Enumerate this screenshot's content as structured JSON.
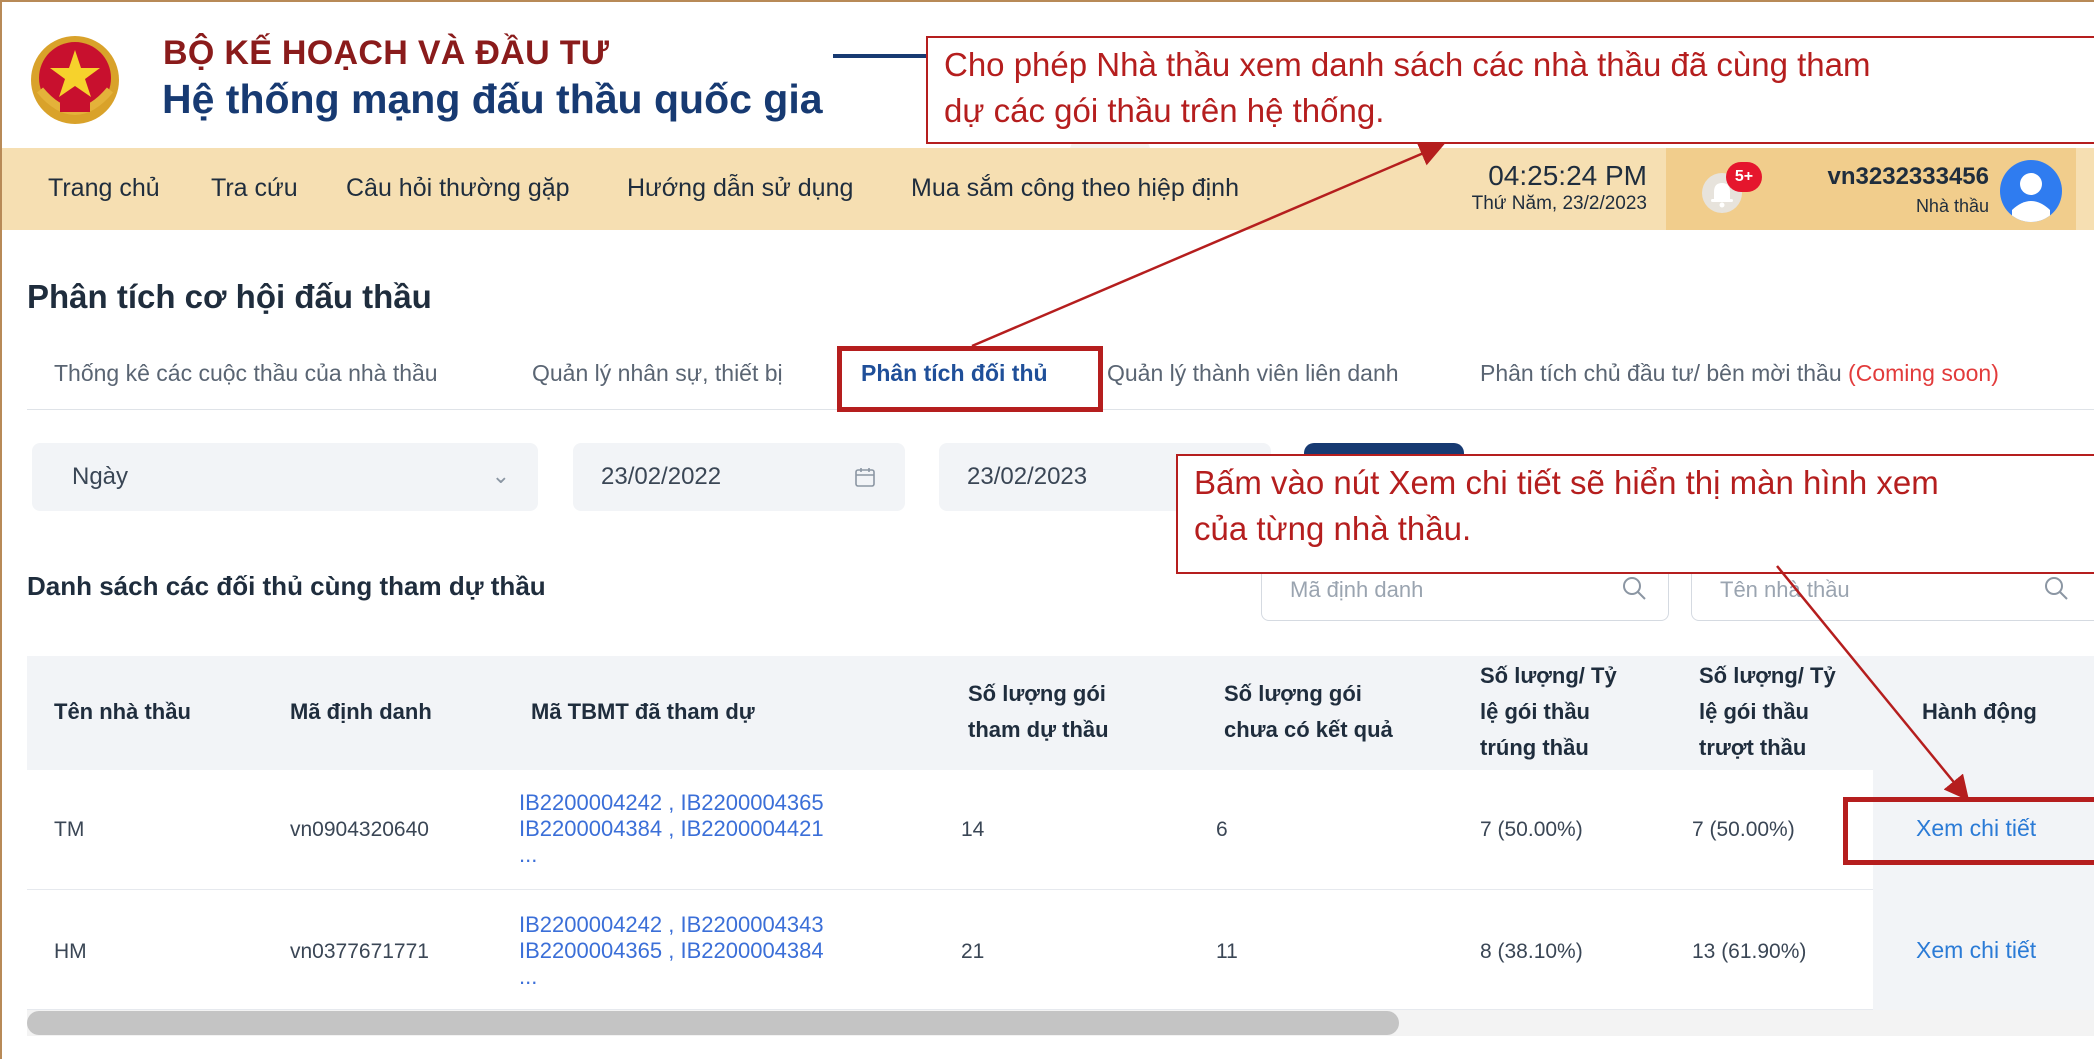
{
  "header": {
    "ministry": "BỘ KẾ HOẠCH VÀ ĐẦU TƯ",
    "system_name": "Hệ thống mạng đấu thầu quốc gia"
  },
  "nav": {
    "items": [
      {
        "label": "Trang chủ"
      },
      {
        "label": "Tra cứu"
      },
      {
        "label": "Câu hỏi thường gặp"
      },
      {
        "label": "Hướng dẫn sử dụng"
      },
      {
        "label": "Mua sắm công theo hiệp định"
      }
    ],
    "time": "04:25:24 PM",
    "date": "Thứ Năm, 23/2/2023",
    "notification_badge": "5+",
    "user_id": "vn3232333456",
    "user_role": "Nhà thầu"
  },
  "page": {
    "title": "Phân tích cơ hội đấu thầu",
    "tabs": [
      {
        "label": "Thống kê các cuộc thầu của nhà thầu"
      },
      {
        "label": "Quản lý nhân sự, thiết bị"
      },
      {
        "label": "Phân tích đối thủ"
      },
      {
        "label": "Quản lý thành viên liên danh"
      },
      {
        "label": "Phân tích chủ đầu tư/ bên mời thầu "
      }
    ],
    "coming_soon": "(Coming soon)"
  },
  "filters": {
    "period": "Ngày",
    "date_from": "23/02/2022",
    "date_to": "23/02/2023"
  },
  "list": {
    "title": "Danh sách các đối thủ cùng tham dự thầu",
    "search_code_placeholder": "Mã định danh",
    "search_name_placeholder": "Tên nhà thầu"
  },
  "table": {
    "headers": {
      "name": "Tên nhà thầu",
      "code": "Mã định danh",
      "tbmt": "Mã TBMT đã tham dự",
      "count_l1": "Số lượng gói",
      "count_l2": "tham dự thầu",
      "pending_l1": "Số lượng gói",
      "pending_l2": "chưa có kết quả",
      "won_l1": "Số lượng/ Tỷ",
      "won_l2": "lệ gói thầu",
      "won_l3": "trúng thầu",
      "lost_l1": "Số lượng/ Tỷ",
      "lost_l2": "lệ gói thầu",
      "lost_l3": "trượt thầu",
      "action": "Hành động"
    },
    "rows": [
      {
        "name": "TM",
        "code": "vn0904320640",
        "codes_l1": "IB2200004242 , IB2200004365",
        "codes_l2": "IB2200004384 , IB2200004421",
        "codes_more": "...",
        "participated": "14",
        "pending": "6",
        "won": "7 (50.00%)",
        "lost": "7 (50.00%)",
        "action": "Xem chi tiết"
      },
      {
        "name": "HM",
        "code": "vn0377671771",
        "codes_l1": "IB2200004242 , IB2200004343",
        "codes_l2": "IB2200004365 , IB2200004384",
        "codes_more": "...",
        "participated": "21",
        "pending": "11",
        "won": "8 (38.10%)",
        "lost": "13 (61.90%)",
        "action": "Xem chi tiết"
      }
    ]
  },
  "annotations": {
    "callout_1_l1": "Cho phép Nhà thầu xem danh sách các nhà thầu đã cùng tham",
    "callout_1_l2": "dự các gói thầu trên hệ thống.",
    "callout_2_l1": "Bấm vào nút Xem chi tiết sẽ hiển thị màn hình xem",
    "callout_2_l2": "của từng nhà thầu.",
    "color": "#b51e1e"
  },
  "icons": {
    "emblem": "national-emblem-icon",
    "bell": "bell-icon",
    "avatar": "user-avatar-icon",
    "calendar": "calendar-icon",
    "search": "search-icon",
    "chevron": "chevron-down-icon"
  }
}
